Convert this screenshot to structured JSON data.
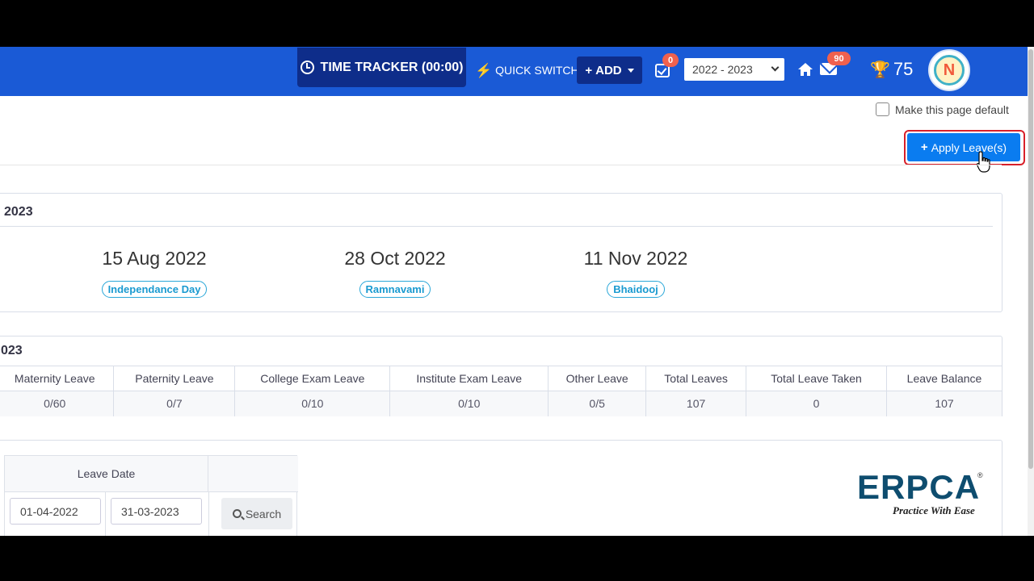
{
  "header": {
    "time_tracker_label": "TIME TRACKER (00:00)",
    "quick_switch_label": "QUICK SWITCH",
    "add_label": "ADD",
    "task_badge": "0",
    "mail_badge": "90",
    "year_selected": "2022 - 2023",
    "trophy_points": "75",
    "avatar_initial": "N",
    "colors": {
      "bar": "#1a5ad6",
      "dark_button": "#0e2d8a",
      "badge": "#f0614e",
      "trophy": "#f7c22b"
    },
    "icons": [
      "clock-icon",
      "bolt-icon",
      "plus-icon",
      "caret-icon",
      "task-check-icon",
      "home-icon",
      "mail-icon",
      "trophy-icon"
    ]
  },
  "page": {
    "make_default_label": "Make this page default",
    "apply_button_label": "Apply Leave(s)",
    "apply_button_color": "#0a7cf0",
    "highlight_color": "#d8202a"
  },
  "holidays": {
    "title": "2023",
    "items": [
      {
        "date": "15 Aug 2022",
        "name": "Independance Day"
      },
      {
        "date": "28 Oct 2022",
        "name": "Ramnavami"
      },
      {
        "date": "11 Nov 2022",
        "name": "Bhaidooj"
      }
    ]
  },
  "summary": {
    "title": "023",
    "columns": [
      "Maternity Leave",
      "Paternity Leave",
      "College Exam Leave",
      "Institute Exam Leave",
      "Other Leave",
      "Total Leaves",
      "Total Leave Taken",
      "Leave Balance"
    ],
    "values": [
      "0/60",
      "0/7",
      "0/10",
      "0/10",
      "0/5",
      "107",
      "0",
      "107"
    ]
  },
  "filter": {
    "leave_date_label": "Leave Date",
    "from_date": "01-04-2022",
    "to_date": "31-03-2023",
    "search_label": "Search"
  },
  "logo": {
    "name": "ERPCA",
    "registered": "®",
    "tagline": "Practice With Ease"
  }
}
